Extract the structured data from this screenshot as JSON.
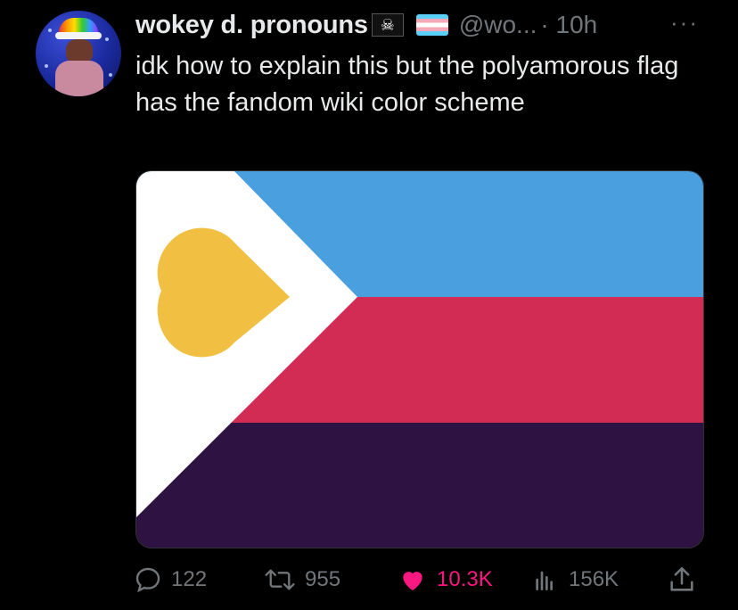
{
  "tweet": {
    "display_name": "wokey d. pronouns",
    "name_emoji": "☠",
    "handle": "@wo...",
    "time": "· 10h",
    "more_label": "···",
    "text": "idk how to explain this but the polyamorous flag has the fandom wiki color scheme"
  },
  "media": {
    "alt": "polyamorous flag",
    "colors": {
      "blue": "#4a9fdf",
      "red": "#d32c54",
      "purple": "#2e1241",
      "white": "#ffffff",
      "heart": "#f1bf42"
    }
  },
  "actions": {
    "replies": "122",
    "retweets": "955",
    "likes": "10.3K",
    "views": "156K"
  },
  "colors": {
    "background": "#000000",
    "text": "#e7e9ea",
    "muted": "#71767b",
    "like": "#f91880"
  }
}
